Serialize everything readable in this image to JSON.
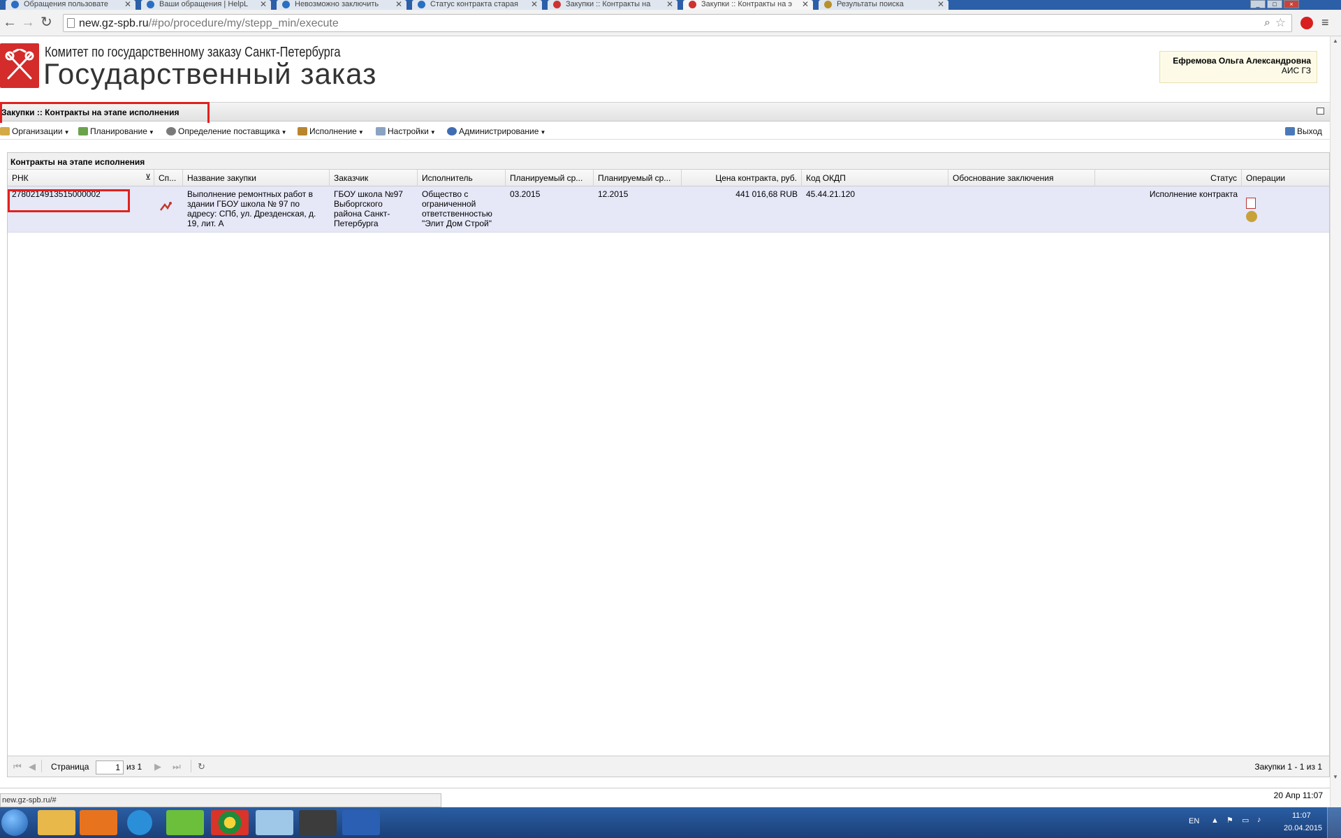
{
  "browser": {
    "tabs": [
      {
        "label": "Обращения пользовате",
        "active": false
      },
      {
        "label": "Ваши обращения | HelpL",
        "active": false
      },
      {
        "label": "Невозможно заключить",
        "active": false
      },
      {
        "label": "Статус контракта старая",
        "active": false
      },
      {
        "label": "Закупки :: Контракты на",
        "active": false
      },
      {
        "label": "Закупки :: Контракты на э",
        "active": true
      },
      {
        "label": "Результаты поиска",
        "active": false
      }
    ],
    "close_glyph": "✕",
    "url_host": "new.gz-spb.ru",
    "url_path": "/#po/procedure/my/stepp_min/execute"
  },
  "header": {
    "org_line": "Комитет по государственному заказу Санкт-Петербурга",
    "site_title": "Государственный заказ",
    "user_name": "Ефремова Ольга Александровна",
    "user_system": "АИС ГЗ"
  },
  "page_title": "Закупки :: Контракты на этапе исполнения",
  "menu": {
    "items": [
      {
        "label": "Организации",
        "icon": "folder-icon"
      },
      {
        "label": "Планирование",
        "icon": "planning-icon"
      },
      {
        "label": "Определение поставщика",
        "icon": "gears-icon"
      },
      {
        "label": "Исполнение",
        "icon": "execution-icon"
      },
      {
        "label": "Настройки",
        "icon": "wrench-icon"
      },
      {
        "label": "Администрирование",
        "icon": "user-icon"
      }
    ],
    "logout": "Выход"
  },
  "grid": {
    "title": "Контракты на этапе исполнения",
    "columns": [
      "РНК",
      "Сп...",
      "Название закупки",
      "Заказчик",
      "Исполнитель",
      "Планируемый ср...",
      "Планируемый ср...",
      "Цена контракта, руб.",
      "Код ОКДП",
      "Обоснование заключения",
      "Статус",
      "Операции"
    ],
    "rows": [
      {
        "rnk": "2780214913515000002",
        "name": "Выполнение ремонтных работ в\nздании ГБОУ школа № 97 по\nадресу: СПб, ул. Дрезденская, д.\n19, лит. А",
        "customer": "ГБОУ школа №97\nВыборгского\nрайона Санкт-\nПетербурга",
        "supplier": "Общество с\nограниченной\nответственностью\n\"Элит Дом Строй\"",
        "plan_start": "03.2015",
        "plan_end": "12.2015",
        "price": "441 016,68 RUB",
        "okdp": "45.44.21.120",
        "basis": "",
        "status": "Исполнение контракта"
      }
    ],
    "pager": {
      "page_label": "Страница",
      "page_value": "1",
      "of_label": "из 1",
      "summary": "Закупки 1 - 1 из 1"
    }
  },
  "statusbar": {
    "url_tip": "new.gz-spb.ru/#",
    "datetime": "20 Апр 11:07"
  },
  "taskbar": {
    "lang": "EN",
    "time": "11:07",
    "date": "20.04.2015"
  },
  "colors": {
    "highlight_red": "#e0211f",
    "row_selected": "#e6e8f8",
    "brand_red": "#d42b2b"
  }
}
